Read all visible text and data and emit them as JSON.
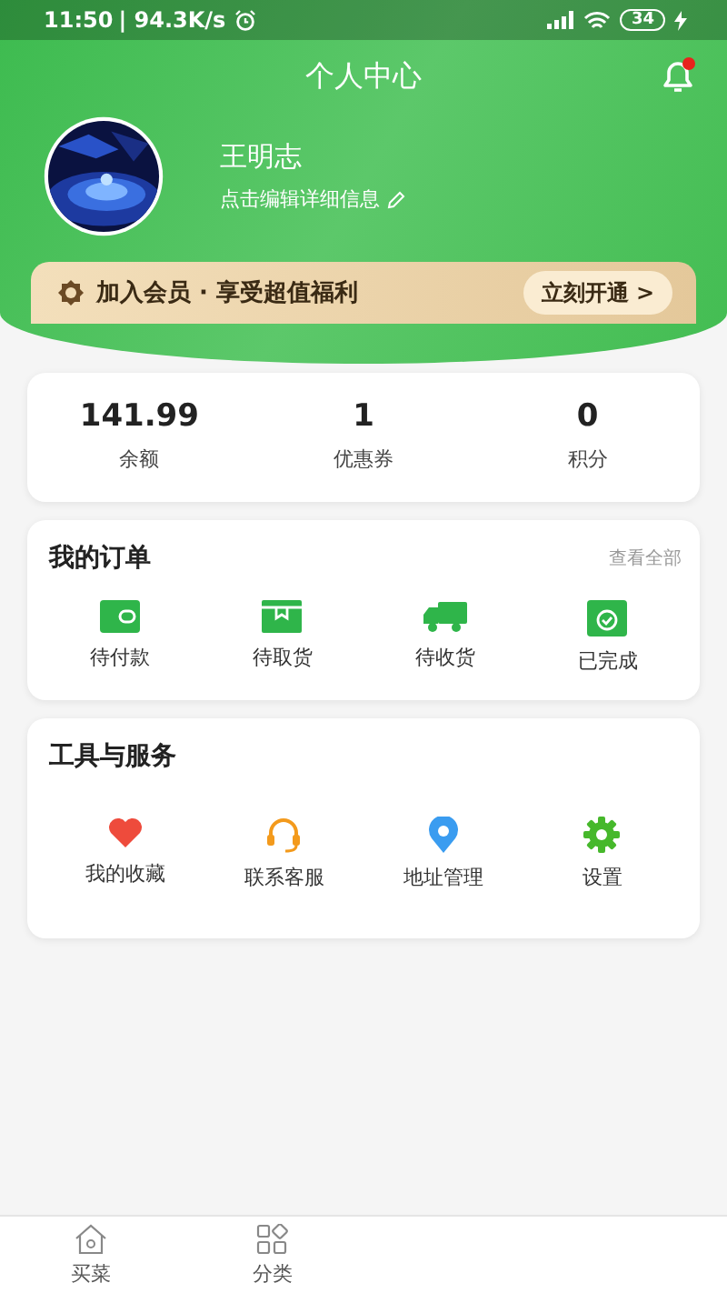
{
  "status_bar": {
    "time": "11:50",
    "speed": "| 94.3K/s",
    "battery": "34"
  },
  "header": {
    "title": "个人中心",
    "has_notification": true
  },
  "profile": {
    "name": "王明志",
    "edit_hint": "点击编辑详细信息"
  },
  "member_banner": {
    "text": "加入会员 · 享受超值福利",
    "button": "立刻开通 >"
  },
  "stats": [
    {
      "value": "141.99",
      "label": "余额"
    },
    {
      "value": "1",
      "label": "优惠券"
    },
    {
      "value": "0",
      "label": "积分"
    }
  ],
  "orders": {
    "title": "我的订单",
    "view_all": "查看全部",
    "items": [
      {
        "kind": "wallet",
        "label": "待付款"
      },
      {
        "kind": "box",
        "label": "待取货"
      },
      {
        "kind": "truck",
        "label": "待收货"
      },
      {
        "kind": "done",
        "label": "已完成"
      }
    ]
  },
  "services": {
    "title": "工具与服务",
    "items": [
      {
        "kind": "heart",
        "label": "我的收藏"
      },
      {
        "kind": "headset",
        "label": "联系客服"
      },
      {
        "kind": "pin",
        "label": "地址管理"
      },
      {
        "kind": "gear",
        "label": "设置"
      }
    ]
  },
  "tab_bar": [
    {
      "kind": "home",
      "label": "买菜"
    },
    {
      "kind": "grid",
      "label": "分类"
    }
  ]
}
